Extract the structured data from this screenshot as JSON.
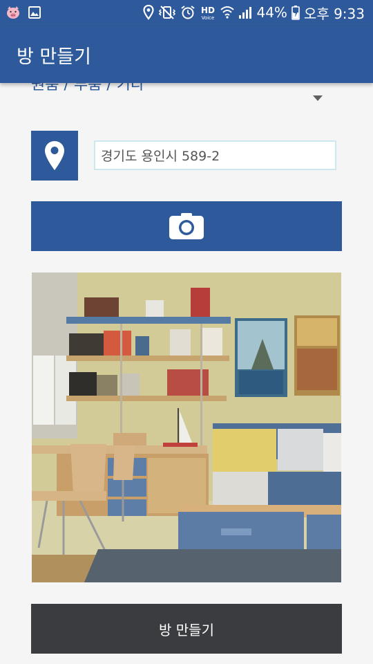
{
  "status_bar": {
    "battery_percent": "44%",
    "time": "오후 9:33",
    "hd_label": "HD",
    "voice_label": "Voice",
    "icons": [
      "pig-app-icon",
      "gallery-icon",
      "location-icon",
      "vibrate-mute-icon",
      "alarm-icon",
      "wifi-icon",
      "signal-icon",
      "battery-charging-icon"
    ]
  },
  "app_bar": {
    "title": "방 만들기"
  },
  "form": {
    "spinner_text": "원룸 / 투룸 / 기타",
    "address_value": "경기도 용인시 589-2",
    "location_icon": "map-marker-icon",
    "camera_icon": "camera-icon",
    "create_button_label": "방 만들기"
  },
  "colors": {
    "primary": "#2e5a9c",
    "dark_button": "#3a3c3f",
    "background": "#f5f5f5",
    "input_border": "#cde7ee"
  }
}
